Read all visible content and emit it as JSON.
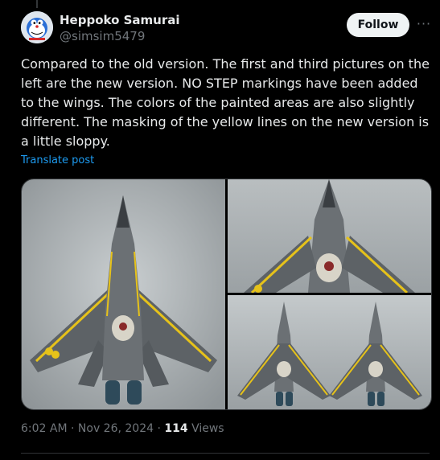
{
  "author": {
    "name": "Heppoko Samurai",
    "handle": "@simsim5479"
  },
  "actions": {
    "follow_label": "Follow",
    "more_label": "···"
  },
  "tweet": {
    "text": "Compared to the old version. The first and third pictures on the left are the new version. NO STEP markings have been added to the wings. The colors of the painted areas are also slightly different. The masking of the yellow lines on the new version is a little sloppy.",
    "translate_label": "Translate post"
  },
  "meta": {
    "time": "6:02 AM",
    "separator1": " · ",
    "date": "Nov 26, 2024",
    "separator2": " · ",
    "views_count": "114",
    "views_label": " Views"
  },
  "media": {
    "photos": [
      {
        "name": "photo-1",
        "subject": "model-jet-top-view"
      },
      {
        "name": "photo-2",
        "subject": "model-jet-nose-closeup"
      },
      {
        "name": "photo-3",
        "subject": "two-model-jets-comparison"
      }
    ]
  },
  "colors": {
    "background": "#000000",
    "text": "#e7e9ea",
    "muted": "#71767b",
    "link": "#1d9bf0",
    "border": "#333639"
  }
}
